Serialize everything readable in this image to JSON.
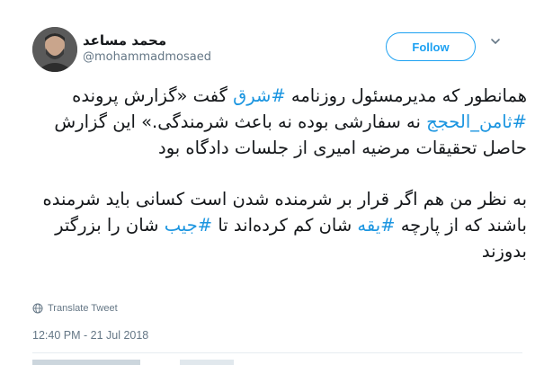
{
  "user": {
    "display_name": "محمد مساعد",
    "screen_name": "@mohammadmosaed"
  },
  "follow_label": "Follow",
  "tweet": {
    "paragraph1": [
      {
        "t": "همانطور که مدیرمسئول روزنامه "
      },
      {
        "t": "#شرق",
        "tag": true
      },
      {
        "t": " گفت «گزارش پرونده "
      },
      {
        "t": "#ثامن_الحجج",
        "tag": true
      },
      {
        "t": " نه سفارشی بوده نه باعث شرمندگی.» این گزارش حاصل تحقیقات مرضیه امیری از جلسات دادگاه بود"
      }
    ],
    "paragraph2": [
      {
        "t": "به نظر من هم اگر قرار بر شرمنده شدن است کسانی باید شرمنده باشند که از پارچه "
      },
      {
        "t": "#یقه",
        "tag": true
      },
      {
        "t": " شان کم کرده‌اند تا "
      },
      {
        "t": "#جیب",
        "tag": true
      },
      {
        "t": " شان را بزرگتر بدوزند"
      }
    ]
  },
  "translate_label": "Translate Tweet",
  "timestamp": "12:40 PM - 21 Jul 2018",
  "colors": {
    "accent": "#1da1f2",
    "hashtag": "#1b95e0",
    "secondary_text": "#657786"
  }
}
